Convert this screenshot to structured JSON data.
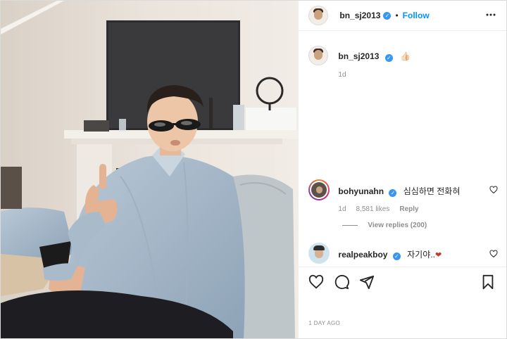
{
  "post": {
    "username": "bn_sj2013",
    "follow_label": "Follow",
    "separator": "•",
    "caption": {
      "username": "bn_sj2013",
      "emoji": "👍🏻",
      "time": "1d"
    },
    "comments": [
      {
        "username": "bohyunahn",
        "text": "심심하면 전화혀",
        "time": "1d",
        "likes": "8,581 likes",
        "reply_label": "Reply",
        "view_replies": "View replies (200)"
      },
      {
        "username": "realpeakboy",
        "text": "자기야..",
        "heart": "❤"
      }
    ],
    "date": "1 DAY AGO"
  },
  "icons": {
    "verified": "verified-badge",
    "more": "more-horizontal-icon",
    "like": "heart-outline-icon",
    "comment": "comment-bubble-icon",
    "share": "paper-plane-icon",
    "save": "bookmark-icon"
  },
  "colors": {
    "accent": "#0095f6",
    "verified": "#3897f0",
    "muted": "#8e8e8e",
    "border": "#dbdbdb",
    "heart": "#c0392b"
  }
}
